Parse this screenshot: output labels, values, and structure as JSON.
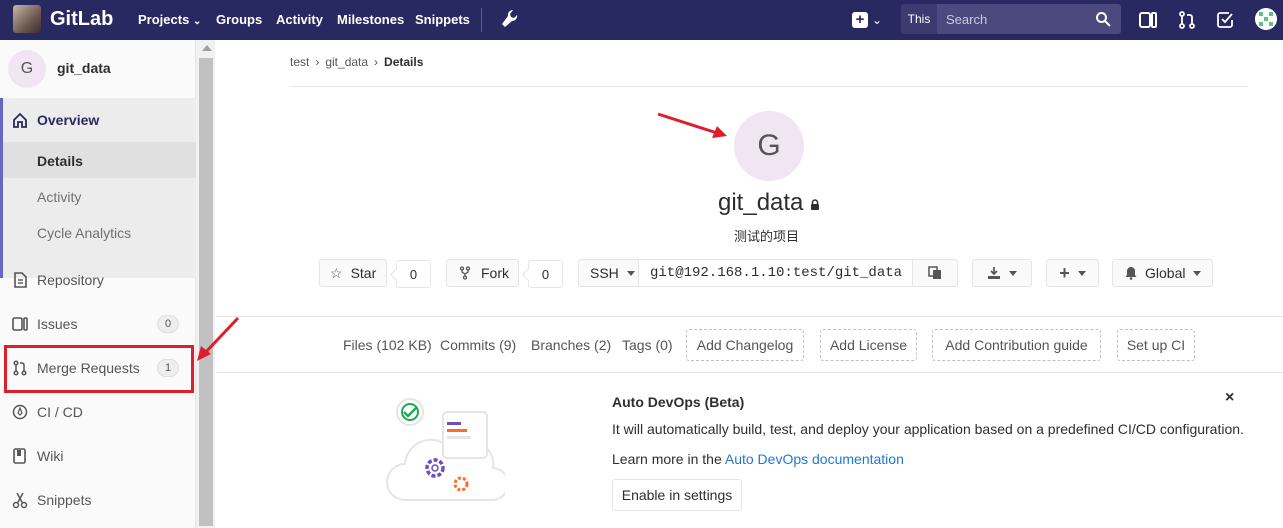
{
  "navbar": {
    "brand": "GitLab",
    "links": [
      {
        "label": "Projects",
        "dropdown": true
      },
      {
        "label": "Groups"
      },
      {
        "label": "Activity"
      },
      {
        "label": "Milestones"
      },
      {
        "label": "Snippets"
      }
    ],
    "search_scope": "This project",
    "search_placeholder": "Search"
  },
  "sidebar": {
    "project_avatar_letter": "G",
    "project_name": "git_data",
    "overview": "Overview",
    "sub_items": [
      "Details",
      "Activity",
      "Cycle Analytics"
    ],
    "items": [
      {
        "label": "Repository",
        "icon": "document-icon"
      },
      {
        "label": "Issues",
        "icon": "issues-icon",
        "badge": "0"
      },
      {
        "label": "Merge Requests",
        "icon": "merge-request-icon",
        "badge": "1"
      },
      {
        "label": "CI / CD",
        "icon": "rocket-icon"
      },
      {
        "label": "Wiki",
        "icon": "book-icon"
      },
      {
        "label": "Snippets",
        "icon": "scissors-icon"
      }
    ]
  },
  "breadcrumb": {
    "items": [
      "test",
      "git_data",
      "Details"
    ]
  },
  "project": {
    "avatar_letter": "G",
    "name": "git_data",
    "description": "测试的项目",
    "star_label": "Star",
    "star_count": "0",
    "fork_label": "Fork",
    "fork_count": "0",
    "protocol": "SSH",
    "clone_url": "git@192.168.1.10:test/git_data",
    "notification": "Global"
  },
  "stats": {
    "files": "Files (102 KB)",
    "commits": "Commits (9)",
    "branches": "Branches (2)",
    "tags": "Tags (0)",
    "add_changelog": "Add Changelog",
    "add_license": "Add License",
    "add_contribution": "Add Contribution guide",
    "setup_ci": "Set up CI"
  },
  "devops": {
    "title": "Auto DevOps (Beta)",
    "text": "It will automatically build, test, and deploy your application based on a predefined CI/CD configuration.",
    "learn_prefix": "Learn more in the",
    "learn_link": "Auto DevOps documentation",
    "enable_button": "Enable in settings",
    "close": "×"
  },
  "colors": {
    "navbar": "#292961",
    "annotation": "#e11d2b",
    "link": "#1f78d1"
  }
}
